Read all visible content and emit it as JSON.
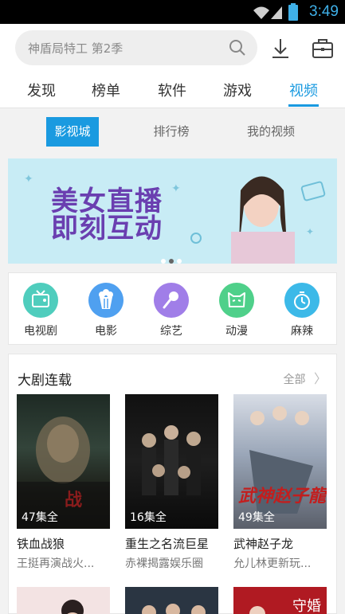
{
  "status": {
    "time": "3:49"
  },
  "search": {
    "placeholder": "神盾局特工 第2季"
  },
  "tabs": [
    "发现",
    "榜单",
    "软件",
    "游戏",
    "视频"
  ],
  "active_tab": "视频",
  "subtabs": [
    "影视城",
    "排行榜",
    "我的视频"
  ],
  "banner": {
    "line1": "美女直播",
    "line2": "即刻互动",
    "slides": 3,
    "current_slide": 2
  },
  "categories": [
    {
      "label": "电视剧",
      "icon": "tv-icon",
      "color": "#4fcdbd"
    },
    {
      "label": "电影",
      "icon": "popcorn-icon",
      "color": "#4fa0f0"
    },
    {
      "label": "综艺",
      "icon": "microphone-icon",
      "color": "#a07ee8"
    },
    {
      "label": "动漫",
      "icon": "mask-icon",
      "color": "#4fd08a"
    },
    {
      "label": "麻辣",
      "icon": "timer-icon",
      "color": "#3cb9e8"
    }
  ],
  "section": {
    "title": "大剧连载",
    "more": "全部",
    "items": [
      {
        "episodes": "47集全",
        "title": "铁血战狼",
        "subtitle": "王挺再演战火..."
      },
      {
        "episodes": "16集全",
        "title": "重生之名流巨星",
        "subtitle": "赤裸揭露娱乐圈"
      },
      {
        "episodes": "49集全",
        "title": "武神赵子龙",
        "subtitle": "允儿林更新玩..."
      }
    ]
  },
  "colors": {
    "accent": "#1a9ae0"
  }
}
